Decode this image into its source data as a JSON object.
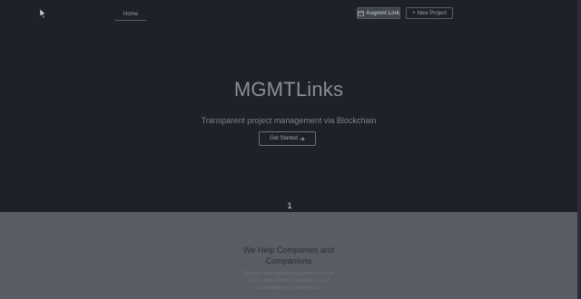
{
  "header": {
    "home_label": "Home",
    "pay_button_label": "Augmnt Link",
    "new_project_label": "New Project"
  },
  "hero": {
    "title": "MGMTLinks",
    "subtitle": "Transparent project management via Blockchain",
    "cta_label": "Get Started"
  },
  "carousel": {
    "slide_number": "1"
  },
  "section": {
    "heading_line1": "We Help Companies and",
    "heading_line2": "Companions",
    "body_line1": "We make sure that everyone involved in your",
    "body_line2": "project stays informed, transparent, and",
    "body_line3": "accountable from start to finish.",
    "body_line4": ""
  },
  "colors": {
    "hero_bg": "#1f2128",
    "section_bg": "#575c65",
    "text_muted": "#8a8f96"
  }
}
